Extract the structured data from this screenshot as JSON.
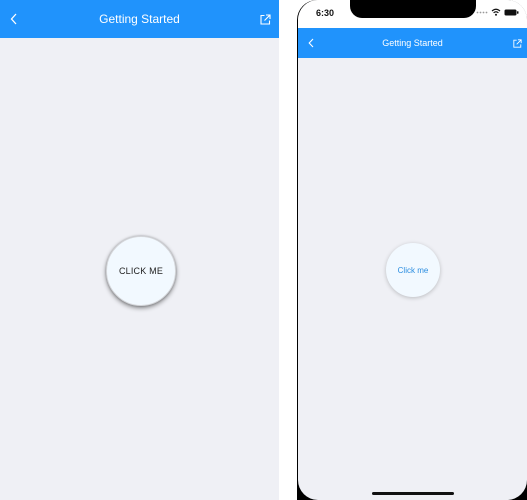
{
  "android": {
    "appbar": {
      "title": "Getting Started",
      "back_icon": "chevron-left-icon",
      "external_icon": "open-external-icon"
    },
    "button_label": "CLICK ME"
  },
  "ios": {
    "status": {
      "time": "6:30",
      "signal_icon": "signal-dots-icon",
      "wifi_icon": "wifi-icon",
      "battery_icon": "battery-icon"
    },
    "navbar": {
      "title": "Getting Started",
      "back_icon": "chevron-left-icon",
      "external_icon": "open-external-icon"
    },
    "button_label": "Click me"
  },
  "colors": {
    "primary": "#2093fc",
    "background": "#eff0f5",
    "button_fill": "#f2f9ff",
    "ios_button_text": "#2a8de0"
  }
}
